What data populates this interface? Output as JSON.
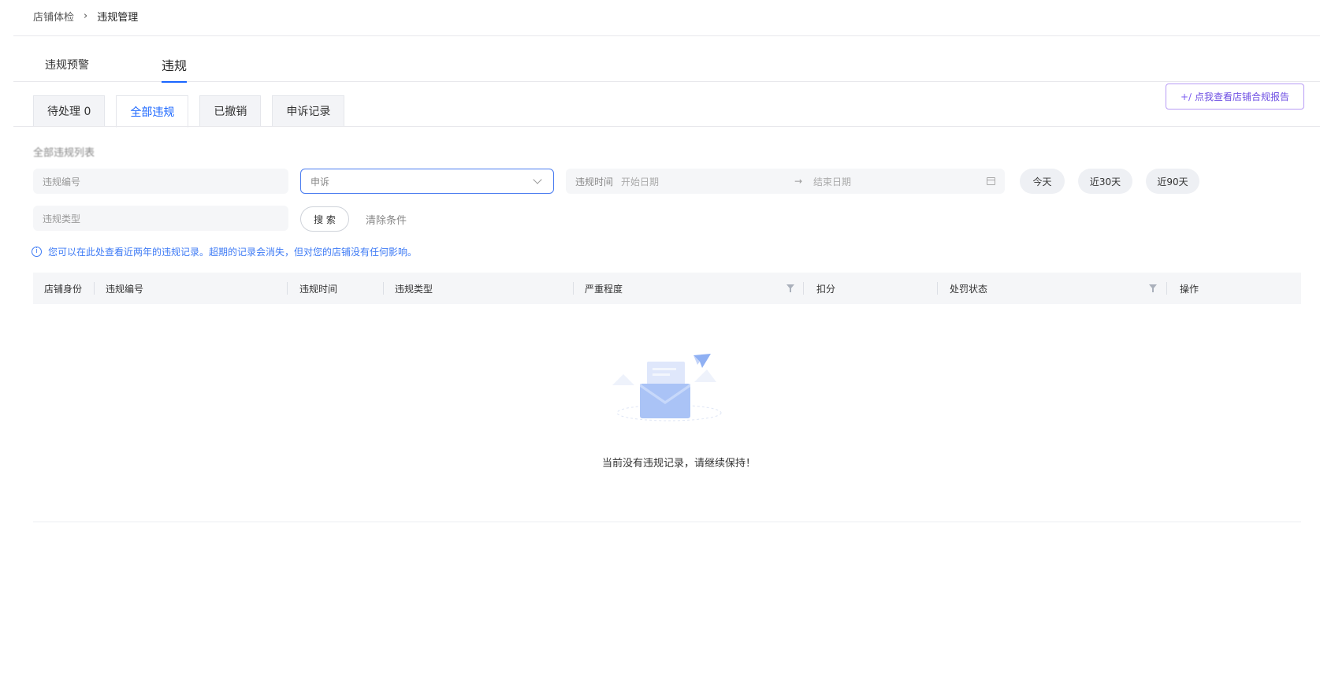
{
  "breadcrumb": {
    "parent": "店铺体检",
    "separator": "›",
    "current": "违规管理"
  },
  "main_tabs": [
    {
      "label": "违规预警"
    },
    {
      "label": "违规"
    }
  ],
  "sub_tabs": [
    {
      "label": "待处理 0"
    },
    {
      "label": "全部违规"
    },
    {
      "label": "已撤销"
    },
    {
      "label": "申诉记录"
    }
  ],
  "report_button": {
    "label": "点我查看店铺合规报告",
    "icon": "sparkle-icon"
  },
  "list_title": "全部违规列表",
  "filters": {
    "violation_id_placeholder": "违规编号",
    "appeal_select_value": "申诉",
    "date_label": "违规时间",
    "start_date_placeholder": "开始日期",
    "end_date_placeholder": "结束日期",
    "violation_type_placeholder": "违规类型",
    "quick_ranges": [
      "今天",
      "近30天",
      "近90天"
    ],
    "search_label": "搜 索",
    "clear_label": "清除条件"
  },
  "notice": "您可以在此处查看近两年的违规记录。超期的记录会消失，但对您的店铺没有任何影响。",
  "table": {
    "columns": [
      "店铺身份",
      "违规编号",
      "违规时间",
      "违规类型",
      "严重程度",
      "扣分",
      "处罚状态",
      "操作"
    ]
  },
  "empty_state": {
    "message": "当前没有违规记录，请继续保持！"
  },
  "colors": {
    "accent": "#1a66ff",
    "notice": "#3d7af5",
    "report_border": "#b89cf5",
    "report_text": "#6d4ee3"
  }
}
